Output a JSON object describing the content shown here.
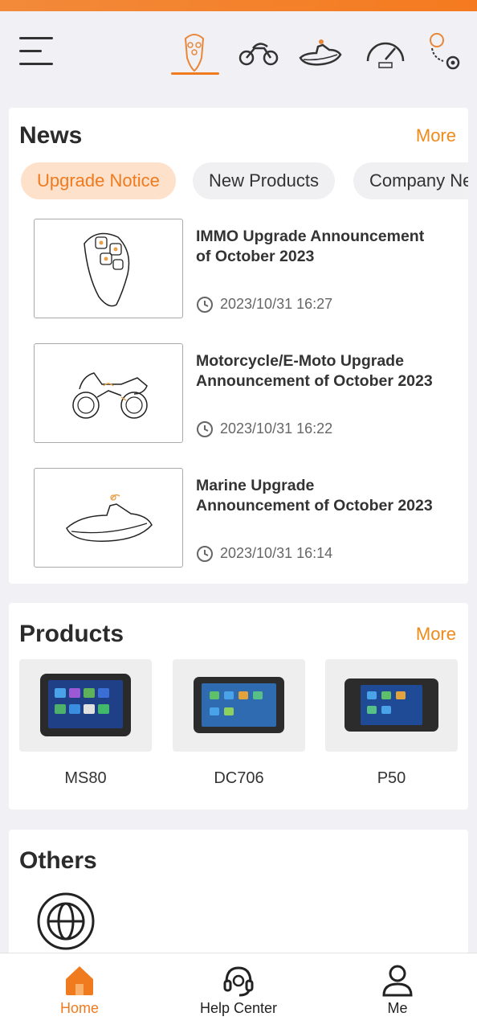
{
  "categories": [
    {
      "name": "immo",
      "icon": "car-key-icon",
      "active": true
    },
    {
      "name": "motorcycle",
      "icon": "motorcycle-icon",
      "active": false
    },
    {
      "name": "marine",
      "icon": "jet-ski-icon",
      "active": false
    },
    {
      "name": "odometer",
      "icon": "speedometer-icon",
      "active": false
    },
    {
      "name": "can",
      "icon": "can-gear-icon",
      "active": false
    }
  ],
  "news": {
    "title": "News",
    "more": "More",
    "tabs": [
      "Upgrade Notice",
      "New Products",
      "Company News"
    ],
    "items": [
      {
        "title_line1": "IMMO Upgrade Announcement",
        "title_line2": "of October 2023",
        "time": "2023/10/31 16:27",
        "thumb": "car-key-illustration"
      },
      {
        "title_line1": "Motorcycle/E-Moto Upgrade",
        "title_line2": "Announcement of October 2023",
        "time": "2023/10/31 16:22",
        "thumb": "motorcycle-illustration"
      },
      {
        "title_line1": "Marine Upgrade",
        "title_line2": "Announcement of October 2023",
        "time": "2023/10/31 16:14",
        "thumb": "jet-ski-illustration"
      }
    ]
  },
  "products": {
    "title": "Products",
    "more": "More",
    "items": [
      {
        "name": "MS80"
      },
      {
        "name": "DC706"
      },
      {
        "name": "P50"
      }
    ]
  },
  "others": {
    "title": "Others",
    "icon": "globe-icon"
  },
  "nav": [
    {
      "label": "Home",
      "icon": "home-icon",
      "active": true
    },
    {
      "label": "Help Center",
      "icon": "headset-icon",
      "active": false
    },
    {
      "label": "Me",
      "icon": "user-icon",
      "active": false
    }
  ],
  "colors": {
    "accent": "#f07a1e",
    "chip_active_bg": "#fde1cb",
    "background": "#f1f1f5"
  }
}
